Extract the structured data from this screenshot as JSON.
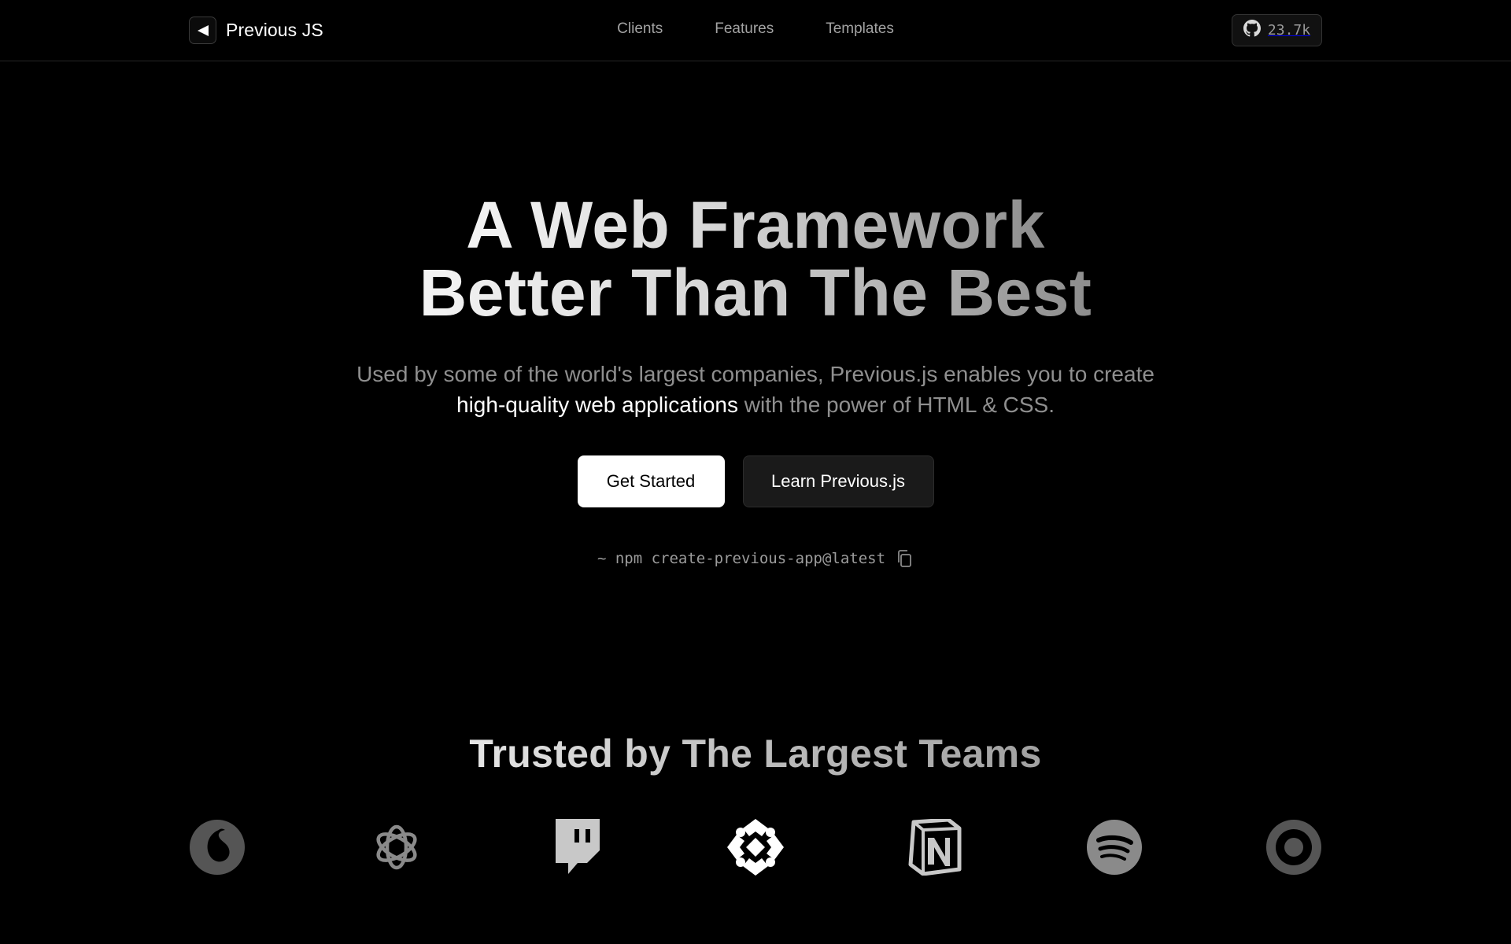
{
  "header": {
    "brand_name": "Previous JS",
    "nav": [
      {
        "label": "Clients"
      },
      {
        "label": "Features"
      },
      {
        "label": "Templates"
      }
    ],
    "github_stars": "23.7k"
  },
  "hero": {
    "title_line1": "A Web Framework",
    "title_line2": "Better Than The Best",
    "subtitle_part1": "Used by some of the world's largest companies, Previous.js enables you to create",
    "subtitle_highlight": "high-quality web applications",
    "subtitle_part2": "with the power of HTML & CSS.",
    "primary_cta": "Get Started",
    "secondary_cta": "Learn Previous.js",
    "install_command": "~ npm create-previous-app@latest"
  },
  "trusted": {
    "title": "Trusted by The Largest Teams",
    "logos": [
      {
        "icon": "vodafone-icon",
        "color": "#5a5a5a"
      },
      {
        "icon": "openai-icon",
        "color": "#8a8a8a"
      },
      {
        "icon": "twitch-icon",
        "color": "#c8c8c8"
      },
      {
        "icon": "ign-icon",
        "color": "#ffffff"
      },
      {
        "icon": "notion-icon",
        "color": "#c8c8c8"
      },
      {
        "icon": "spotify-icon",
        "color": "#8a8a8a"
      },
      {
        "icon": "target-icon",
        "color": "#5a5a5a"
      }
    ]
  },
  "colors": {
    "background": "#000000",
    "nav_text": "#a3a3a3",
    "subtitle_text": "#8f8f8f",
    "highlight_text": "#ffffff",
    "primary_button_bg": "#ffffff",
    "secondary_button_bg": "#1a1a1a"
  }
}
